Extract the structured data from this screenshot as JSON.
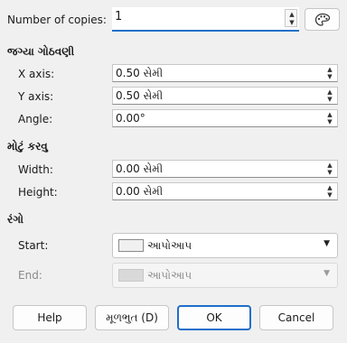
{
  "copies": {
    "label": "Number of copies:",
    "value": "1"
  },
  "placement": {
    "heading": "જગ્યા ગોઠવણી",
    "x_label": "X axis:",
    "x_value": "0.50 સેમી",
    "y_label": "Y axis:",
    "y_value": "0.50 સેમી",
    "angle_label": "Angle:",
    "angle_value": "0.00°"
  },
  "enlargement": {
    "heading": "મોટું કરવુ",
    "width_label": "Width:",
    "width_value": "0.00 સેમી",
    "height_label": "Height:",
    "height_value": "0.00 સેમી"
  },
  "colors": {
    "heading": "રંગો",
    "start_label": "Start:",
    "start_value": "આપોઆપ",
    "end_label": "End:",
    "end_value": "આપોઆપ"
  },
  "buttons": {
    "help": "Help",
    "reset": "મૂળભુત (D)",
    "ok": "OK",
    "cancel": "Cancel"
  },
  "icons": {
    "spin_up": "triangle-up-icon",
    "spin_down": "triangle-down-icon",
    "palette": "palette-icon",
    "dropdown": "chevron-down-icon"
  },
  "accent_color": "#1f6fc9"
}
